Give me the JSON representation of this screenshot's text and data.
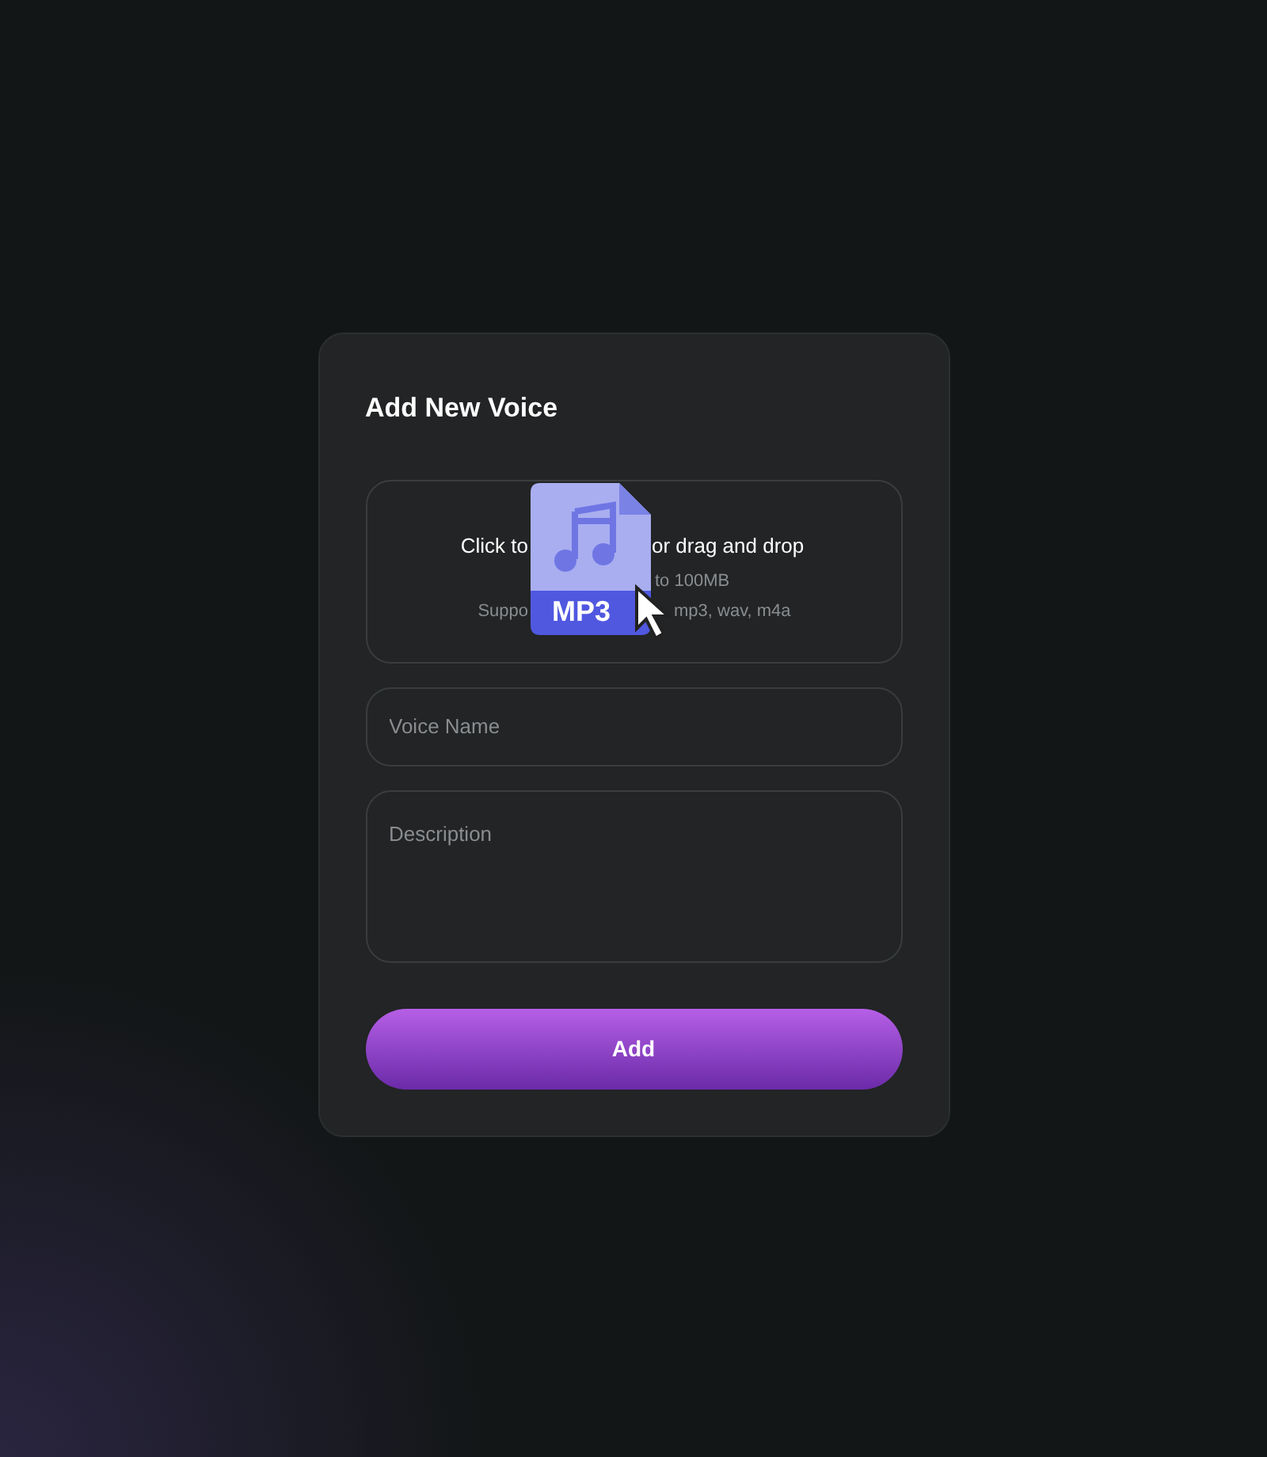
{
  "dialog": {
    "title": "Add New Voice"
  },
  "upload": {
    "prompt_start": "Click to",
    "prompt_end": "or drag and drop",
    "limit": "to 100MB",
    "formats_start": "Suppo",
    "formats_end": "mp3, wav, m4a",
    "file_badge": "MP3"
  },
  "fields": [
    {
      "kind": "input",
      "placeholder": "Voice Name"
    },
    {
      "kind": "textarea",
      "placeholder": "Description"
    }
  ],
  "submit": "Add"
}
